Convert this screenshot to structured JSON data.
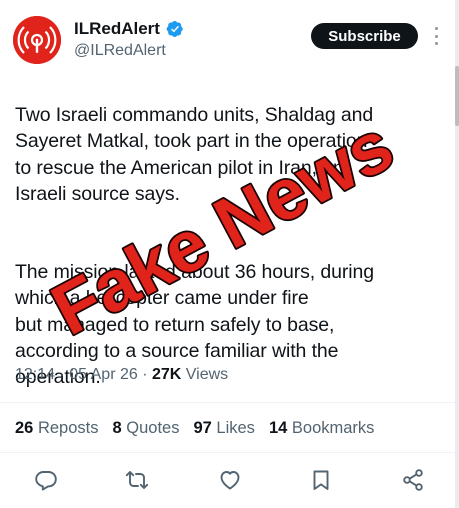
{
  "account": {
    "display_name": "ILRedAlert",
    "handle": "@ILRedAlert",
    "verified": true
  },
  "subscribe_label": "Subscribe",
  "tweet": {
    "paragraph1": "Two Israeli commando units, Shaldag and\nSayeret Matkal, took part in the operation\nto rescue the American pilot in Iran, an\nIsraeli source says.",
    "paragraph2": "The mission lasted about 36 hours, during\nwhich a helicopter came under fire\nbut managed to return safely to base,\naccording to a source familiar with the\noperation."
  },
  "meta": {
    "time": "12:14",
    "separator": " · ",
    "date": "05 Apr 26",
    "views_count": "27K",
    "views_label": " Views"
  },
  "stats": {
    "reposts_count": "26",
    "reposts_label": " Reposts",
    "quotes_count": "8",
    "quotes_label": " Quotes",
    "likes_count": "97",
    "likes_label": " Likes",
    "bookmarks_count": "14",
    "bookmarks_label": " Bookmarks"
  },
  "stamp_text": "Fake News",
  "colors": {
    "accent_red": "#e0241b",
    "verified_blue": "#1d9bf0",
    "text_primary": "#0f1419",
    "text_secondary": "#536471"
  },
  "icons": [
    "reply-icon",
    "repost-icon",
    "like-icon",
    "bookmark-icon",
    "share-icon",
    "verified-badge-icon",
    "more-icon"
  ]
}
